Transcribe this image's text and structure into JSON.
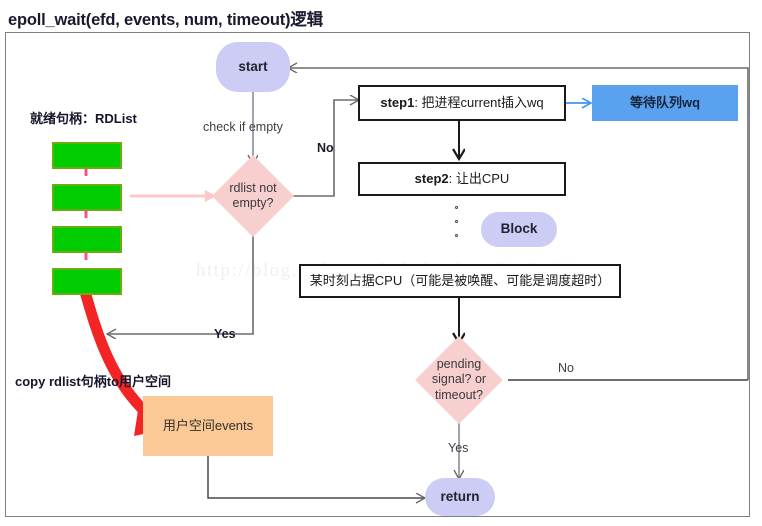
{
  "title": "epoll_wait(efd, events, num, timeout)逻辑",
  "watermark": "http://blog.csdn.net/lishuhuakai_38454662",
  "colors": {
    "terminator": "#ccccf5",
    "decision": "#f8cfcf",
    "wait_queue": "#5aa2f0",
    "events_box": "#fac995",
    "rdlist_cell": "#00cc00",
    "rdlist_cell_border": "#6aad10",
    "copy_arrow": "#f42424",
    "pink_arrow": "#ffc8c8",
    "connector": "#6b6b6b",
    "process_border": "#1a1a1a"
  },
  "nodes": {
    "start": {
      "label": "start",
      "type": "terminator"
    },
    "rdlist_decision": {
      "label_line1": "rdlist not",
      "label_line2": "empty?",
      "type": "decision"
    },
    "step1": {
      "label_bold": "step1",
      "label_rest": ": 把进程current插入wq",
      "type": "process"
    },
    "wait_queue": {
      "label": "等待队列wq",
      "type": "data"
    },
    "step2": {
      "label_bold": "step2",
      "label_rest": ": 让出CPU",
      "type": "process"
    },
    "block": {
      "label": "Block",
      "type": "annotation"
    },
    "occupy_cpu": {
      "label": "某时刻占据CPU（可能是被唤醒、可能是调度超时）",
      "type": "process"
    },
    "pending_decision": {
      "label_line1": "pending",
      "label_line2": "signal? or",
      "label_line3": "timeout?",
      "type": "decision"
    },
    "return": {
      "label": "return",
      "type": "terminator"
    },
    "events": {
      "label": "用户空间events",
      "type": "data"
    }
  },
  "edge_labels": {
    "check_if_empty": "check if empty",
    "no_from_rdlist": "No",
    "yes_from_rdlist": "Yes",
    "no_from_pending": "No",
    "yes_from_pending": "Yes"
  },
  "annotations": {
    "rdlist_title": "就绪句柄：RDList",
    "copy_label": "copy rdlist句柄to用户空间"
  },
  "rdlist": {
    "cell_count": 4,
    "cells": [
      "",
      "",
      "",
      ""
    ]
  }
}
